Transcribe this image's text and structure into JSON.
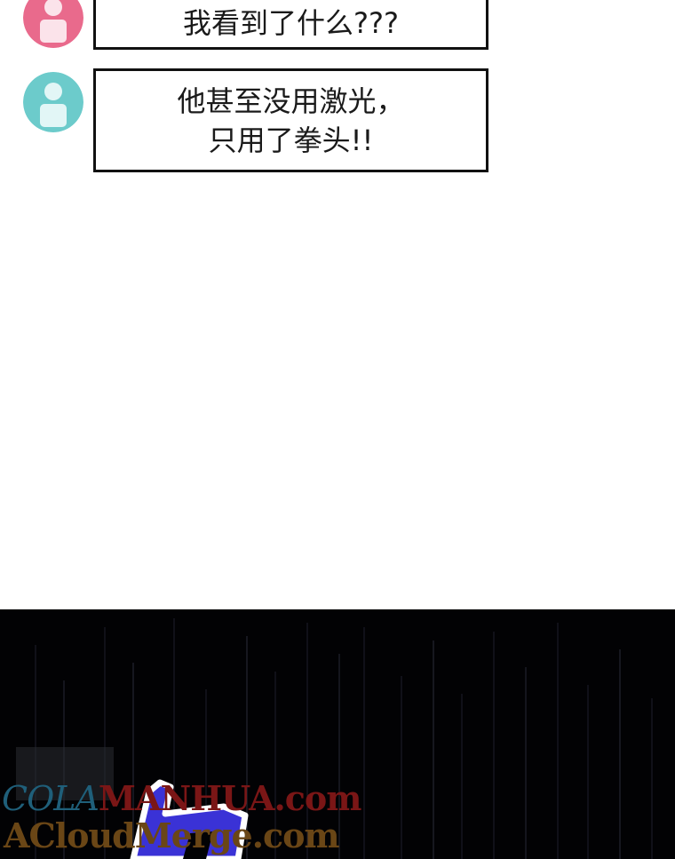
{
  "messages": [
    {
      "avatar": "pink-user-avatar",
      "lines": [
        "我看到了什么???"
      ]
    },
    {
      "avatar": "teal-user-avatar",
      "lines": [
        "他甚至没用激光，",
        "只用了拳头!!"
      ]
    }
  ],
  "watermarks": {
    "line1_a": "COLA",
    "line1_b": "MANHUA",
    "line1_c": ".com",
    "line2": "ACloudMerge.com"
  },
  "colors": {
    "pink_avatar": "#e96a8c",
    "teal_avatar": "#6ccbcb",
    "panel_bg": "#020204",
    "sfx_blue": "#3a32d6"
  }
}
